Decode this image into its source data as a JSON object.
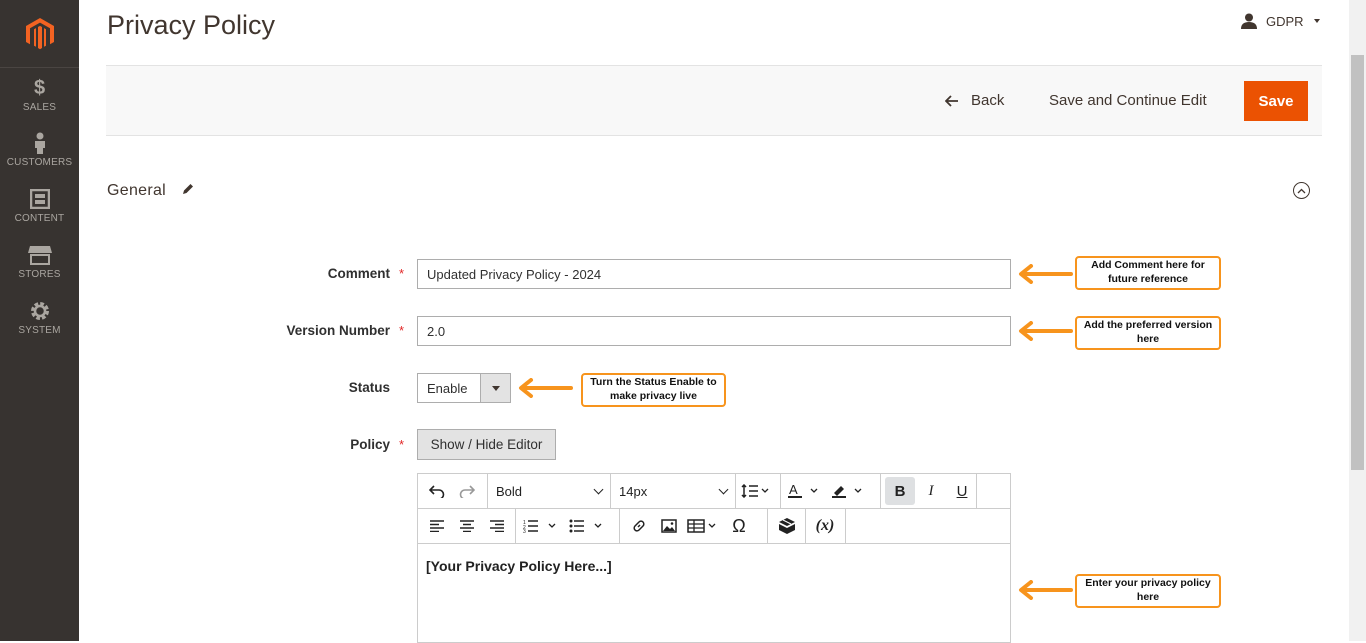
{
  "page": {
    "title": "Privacy Policy"
  },
  "user_menu": {
    "label": "GDPR"
  },
  "sidebar": {
    "items": [
      {
        "label": "SALES",
        "icon": "dollar-icon"
      },
      {
        "label": "CUSTOMERS",
        "icon": "person-icon"
      },
      {
        "label": "CONTENT",
        "icon": "content-icon"
      },
      {
        "label": "STORES",
        "icon": "store-icon"
      },
      {
        "label": "SYSTEM",
        "icon": "gear-icon"
      }
    ]
  },
  "actions": {
    "back_label": "Back",
    "save_continue_label": "Save and Continue Edit",
    "save_label": "Save"
  },
  "section": {
    "title": "General"
  },
  "form": {
    "comment": {
      "label": "Comment",
      "value": "Updated Privacy Policy - 2024"
    },
    "version": {
      "label": "Version Number",
      "value": "2.0"
    },
    "status": {
      "label": "Status",
      "value": "Enable"
    },
    "policy": {
      "label": "Policy",
      "toggle_label": "Show / Hide Editor"
    }
  },
  "editor": {
    "block_format": "Bold",
    "font_size": "14px",
    "content": "[Your Privacy Policy Here...]"
  },
  "callouts": {
    "comment": "Add Comment here for future reference",
    "version": "Add the preferred version here",
    "status": "Turn the Status Enable to make privacy live",
    "policy": "Enter your privacy policy here"
  },
  "colors": {
    "accent": "#eb5202",
    "sidebar_bg": "#373330",
    "callout_border": "#f7941d"
  }
}
